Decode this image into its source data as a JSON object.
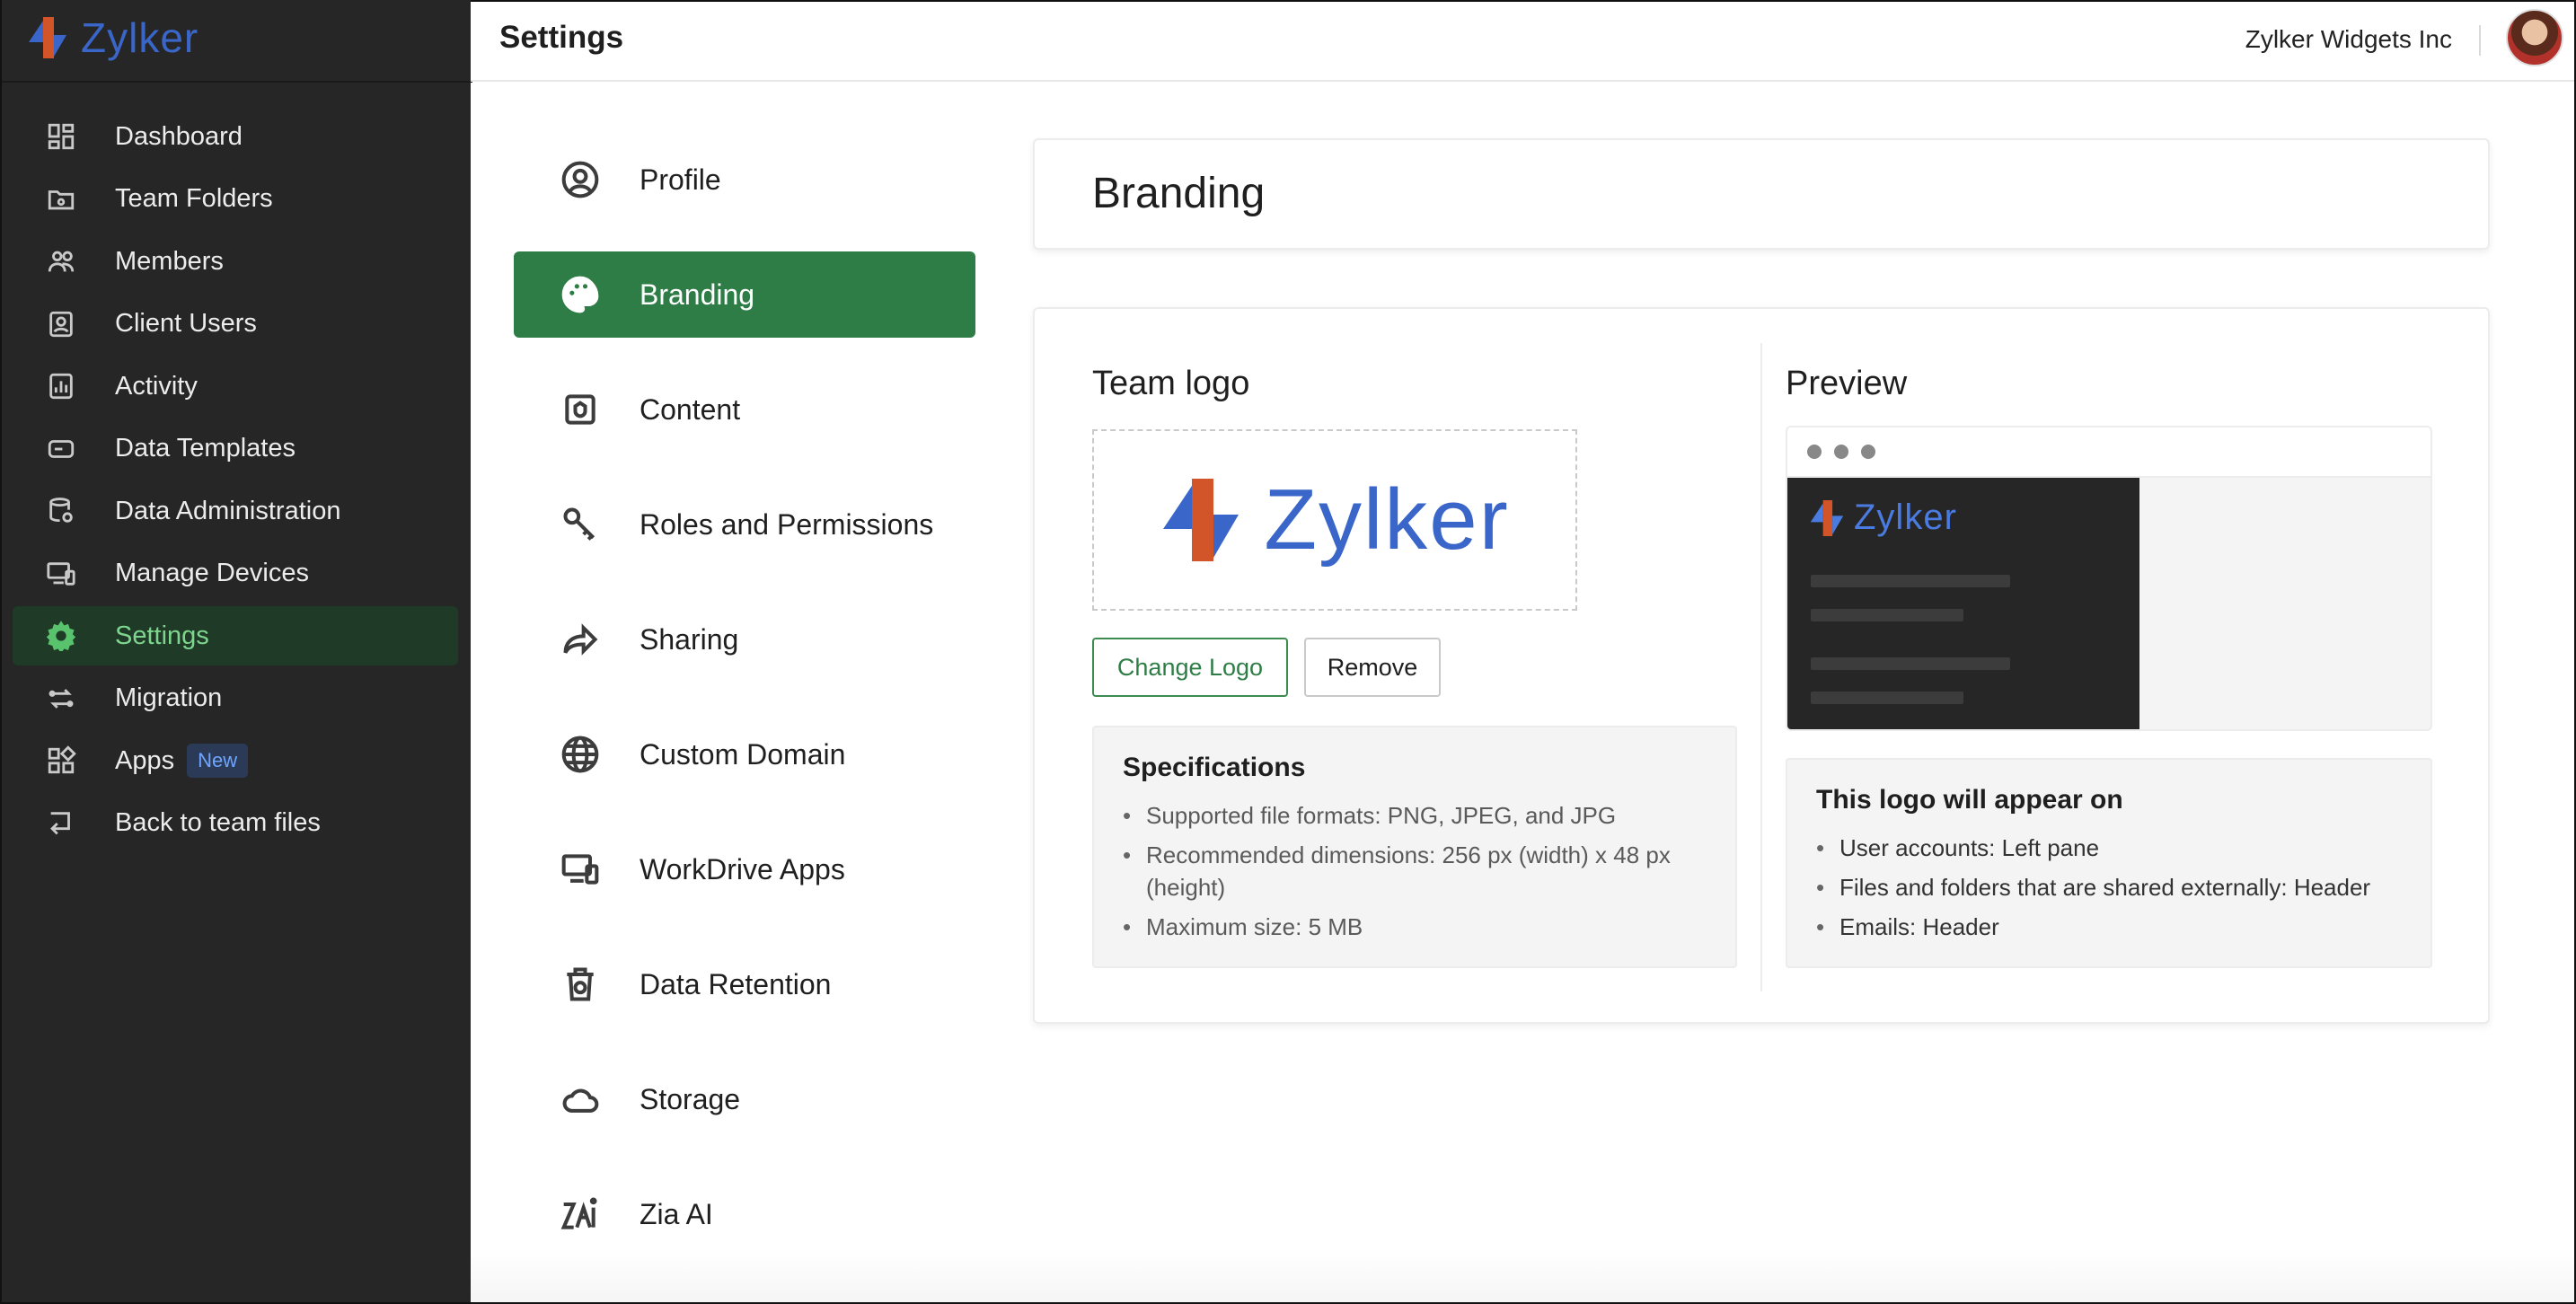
{
  "brand": {
    "name": "Zylker"
  },
  "header": {
    "title": "Settings",
    "org_name": "Zylker Widgets Inc"
  },
  "sidebar": {
    "items": [
      {
        "label": "Dashboard",
        "icon": "dashboard-icon"
      },
      {
        "label": "Team Folders",
        "icon": "team-folder-icon"
      },
      {
        "label": "Members",
        "icon": "members-icon"
      },
      {
        "label": "Client Users",
        "icon": "client-users-icon"
      },
      {
        "label": "Activity",
        "icon": "activity-icon"
      },
      {
        "label": "Data Templates",
        "icon": "data-templates-icon"
      },
      {
        "label": "Data Administration",
        "icon": "data-administration-icon"
      },
      {
        "label": "Manage Devices",
        "icon": "devices-icon"
      },
      {
        "label": "Settings",
        "icon": "gear-icon",
        "active": true
      },
      {
        "label": "Migration",
        "icon": "migration-icon"
      },
      {
        "label": "Apps",
        "icon": "apps-icon",
        "badge": "New"
      },
      {
        "label": "Back to team files",
        "icon": "back-icon"
      }
    ]
  },
  "settings_menu": {
    "items": [
      {
        "label": "Profile",
        "icon": "profile-icon"
      },
      {
        "label": "Branding",
        "icon": "palette-icon",
        "active": true
      },
      {
        "label": "Content",
        "icon": "content-icon"
      },
      {
        "label": "Roles and Permissions",
        "icon": "key-icon"
      },
      {
        "label": "Sharing",
        "icon": "share-icon"
      },
      {
        "label": "Custom Domain",
        "icon": "globe-icon"
      },
      {
        "label": "WorkDrive Apps",
        "icon": "devices-icon"
      },
      {
        "label": "Data Retention",
        "icon": "trash-icon"
      },
      {
        "label": "Storage",
        "icon": "cloud-icon"
      },
      {
        "label": "Zia AI",
        "icon": "zia-icon"
      }
    ]
  },
  "branding": {
    "heading": "Branding",
    "team_logo_title": "Team logo",
    "logo_text": "Zylker",
    "change_logo_label": "Change Logo",
    "remove_label": "Remove",
    "specs": {
      "title": "Specifications",
      "items": [
        "Supported file formats: PNG, JPEG, and JPG",
        "Recommended dimensions: 256 px (width) x 48 px (height)",
        "Maximum size: 5 MB"
      ]
    },
    "preview_title": "Preview",
    "preview_logo_text": "Zylker",
    "appear": {
      "title": "This logo will appear on",
      "items": [
        "User accounts: Left pane",
        "Files and folders that are shared externally: Header",
        "Emails: Header"
      ]
    }
  },
  "colors": {
    "accent_green": "#2f7d46",
    "sidebar_bg": "#262626",
    "brand_blue": "#3a66c9",
    "brand_orange": "#d2552a"
  }
}
